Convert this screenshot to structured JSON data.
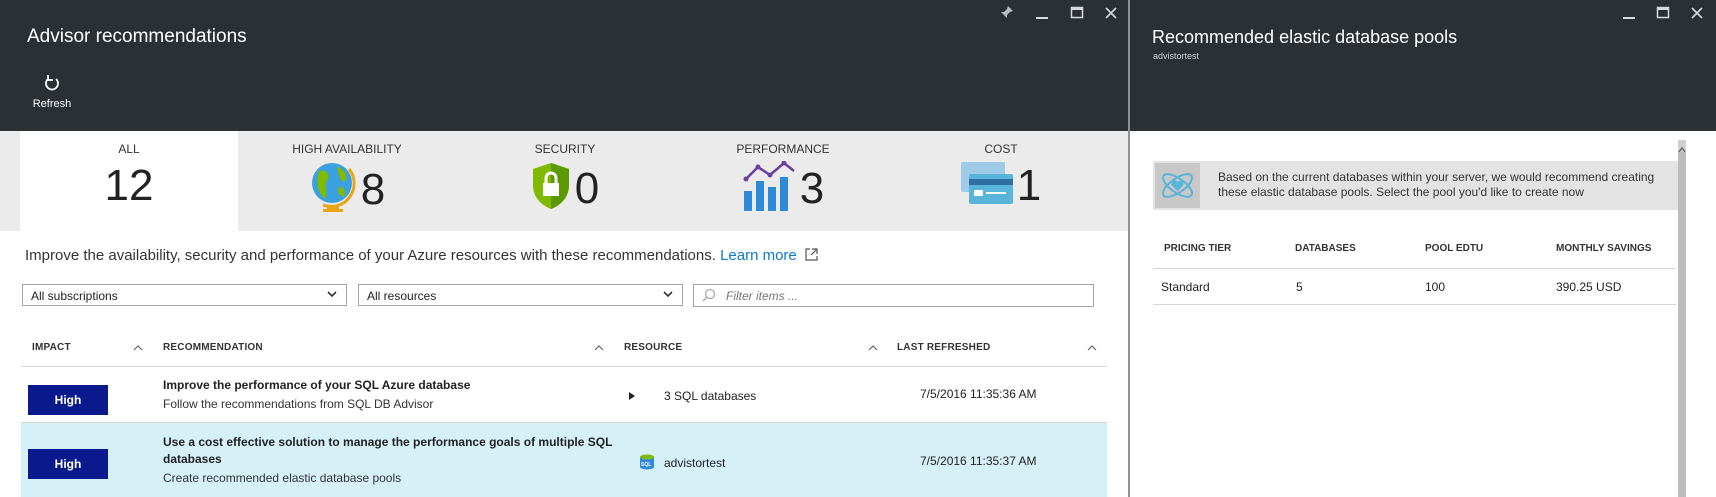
{
  "left_blade": {
    "title": "Advisor recommendations",
    "toolbar": {
      "refresh_label": "Refresh"
    },
    "tabs": [
      {
        "label": "ALL",
        "count": "12",
        "icon": "none",
        "selected": true
      },
      {
        "label": "HIGH AVAILABILITY",
        "count": "8",
        "icon": "globe-icon"
      },
      {
        "label": "SECURITY",
        "count": "0",
        "icon": "shield-lock-icon"
      },
      {
        "label": "PERFORMANCE",
        "count": "3",
        "icon": "performance-chart-icon"
      },
      {
        "label": "COST",
        "count": "1",
        "icon": "credit-card-icon"
      }
    ],
    "intro_text": "Improve the availability, security and performance of your Azure resources with these recommendations.",
    "learn_more": "Learn more",
    "filters": {
      "subscriptions": "All subscriptions",
      "resources": "All resources",
      "search_placeholder": "Filter items ..."
    },
    "table": {
      "columns": [
        "IMPACT",
        "RECOMMENDATION",
        "RESOURCE",
        "LAST REFRESHED"
      ],
      "rows": [
        {
          "impact": "High",
          "title": "Improve the performance of your SQL Azure database",
          "subtitle": "Follow the recommendations from SQL DB Advisor",
          "resource": "3 SQL databases",
          "refreshed": "7/5/2016 11:35:36 AM"
        },
        {
          "impact": "High",
          "title_line1": "Use a cost effective solution to manage the performance goals of multiple SQL",
          "title_line2": "databases",
          "subtitle": "Create recommended elastic database pools",
          "resource": "advistortest",
          "refreshed": "7/5/2016 11:35:37 AM",
          "selected": true
        }
      ]
    }
  },
  "right_blade": {
    "title": "Recommended elastic database pools",
    "subtitle": "advistortest",
    "info_text": "Based on the current databases within your server, we would recommend creating these elastic database pools. Select the pool you'd like to create now",
    "table": {
      "columns": [
        "PRICING TIER",
        "DATABASES",
        "POOL EDTU",
        "MONTHLY SAVINGS"
      ],
      "rows": [
        {
          "pricing_tier": "Standard",
          "databases": "5",
          "pool_edtu": "100",
          "monthly_savings": "390.25 USD"
        }
      ]
    }
  },
  "colors": {
    "header_bg": "#2b3035",
    "impact_high": "#0a1a8c",
    "selected_row": "#d6f0f8",
    "link": "#0a79d0"
  }
}
